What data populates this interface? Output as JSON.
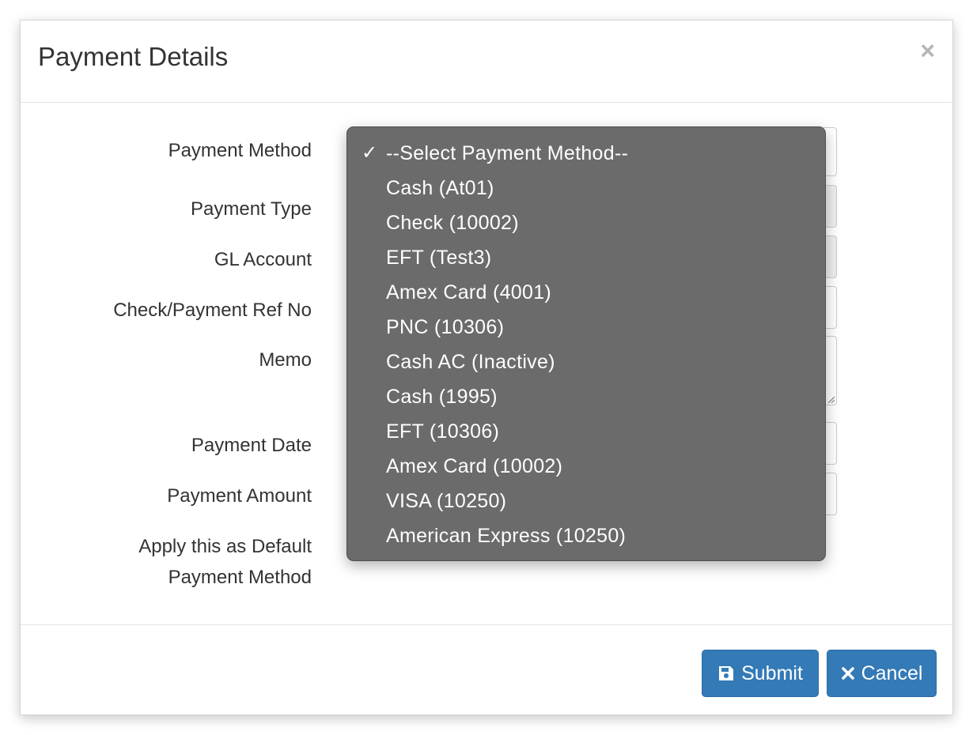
{
  "modal": {
    "title": "Payment Details",
    "close_glyph": "×"
  },
  "form": {
    "labels": {
      "payment_method": "Payment Method",
      "payment_type": "Payment Type",
      "gl_account": "GL Account",
      "ref_no": "Check/Payment Ref No",
      "memo": "Memo",
      "payment_date": "Payment Date",
      "payment_amount": "Payment Amount",
      "default_line1": "Apply this as Default",
      "default_line2": "Payment Method"
    }
  },
  "dropdown": {
    "selected_index": 0,
    "options": [
      "--Select Payment Method--",
      "Cash (At01)",
      "Check (10002)",
      "EFT (Test3)",
      "Amex Card (4001)",
      "PNC (10306)",
      "Cash AC (Inactive)",
      "Cash (1995)",
      "EFT (10306)",
      "Amex Card (10002)",
      "VISA (10250)",
      "American Express (10250)"
    ]
  },
  "footer": {
    "submit_label": "Submit",
    "cancel_label": "Cancel"
  },
  "icons": {
    "close": "close-icon",
    "check": "checkmark-icon",
    "submit": "floppy-disk-icon",
    "cancel": "x-icon"
  },
  "colors": {
    "primary": "#337ab7",
    "dropdown_bg": "#6b6b6b"
  }
}
